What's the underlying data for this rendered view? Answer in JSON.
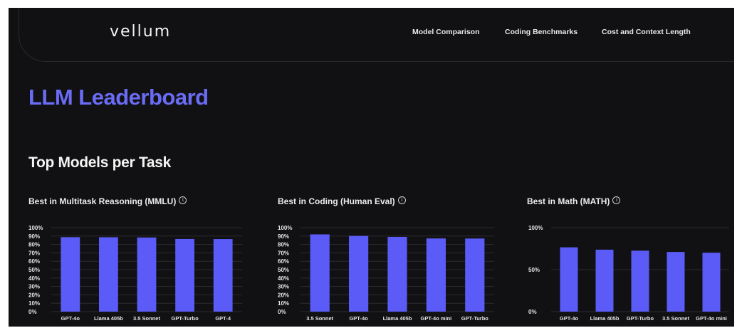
{
  "nav": {
    "logo": "vellum",
    "links": [
      "Model Comparison",
      "Coding Benchmarks",
      "Cost and Context Length"
    ]
  },
  "page_title": "LLM Leaderboard",
  "section_title": "Top Models per Task",
  "colors": {
    "bar": "#5b5bf7",
    "title": "#6a6cf6",
    "background": "#111113"
  },
  "info_icon": "info-circle-icon",
  "chart_data": [
    {
      "type": "bar",
      "title": "Best in Multitask Reasoning (MMLU)",
      "categories": [
        "GPT-4o",
        "Llama 405b",
        "3.5 Sonnet",
        "GPT-Turbo",
        "GPT-4"
      ],
      "values": [
        88.7,
        88.6,
        88.3,
        86.5,
        86.4
      ],
      "ylim": [
        0,
        100
      ],
      "yticks": [
        "0%",
        "10%",
        "20%",
        "30%",
        "40%",
        "50%",
        "60%",
        "70%",
        "80%",
        "90%",
        "100%"
      ],
      "grid": true
    },
    {
      "type": "bar",
      "title": "Best in Coding (Human Eval)",
      "categories": [
        "3.5 Sonnet",
        "GPT-4o",
        "Llama 405b",
        "GPT-4o mini",
        "GPT-Turbo"
      ],
      "values": [
        92.0,
        90.2,
        89.0,
        87.2,
        87.1
      ],
      "ylim": [
        0,
        100
      ],
      "yticks": [
        "0%",
        "10%",
        "20%",
        "30%",
        "40%",
        "50%",
        "60%",
        "70%",
        "80%",
        "90%",
        "100%"
      ],
      "grid": true
    },
    {
      "type": "bar",
      "title": "Best in Math (MATH)",
      "categories": [
        "GPT-4o",
        "Llama 405b",
        "GPT-Turbo",
        "3.5 Sonnet",
        "GPT-4o mini"
      ],
      "values": [
        76.6,
        73.8,
        72.6,
        71.1,
        70.2
      ],
      "ylim": [
        0,
        100
      ],
      "yticks": [
        "0%",
        "50%",
        "100%"
      ],
      "grid": true
    }
  ]
}
